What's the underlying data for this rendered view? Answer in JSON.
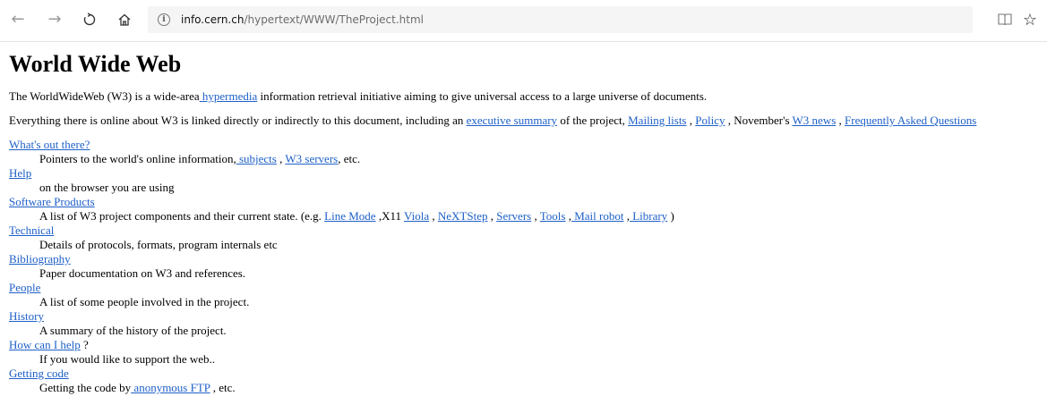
{
  "browser": {
    "url_host": "info.cern.ch",
    "url_path": "/hypertext/WWW/TheProject.html",
    "icons": [
      "back-arrow-icon",
      "forward-arrow-icon",
      "reload-icon",
      "home-icon",
      "info-icon",
      "reading-view-icon",
      "star-icon"
    ]
  },
  "page": {
    "title": "World Wide Web",
    "intro": {
      "t1": "The WorldWideWeb (W3) is a wide-area",
      "link_hypermedia": " hypermedia",
      "t2": " information retrieval initiative aiming to give universal access to a large universe of documents."
    },
    "everything": {
      "t1": "Everything there is online about W3 is linked directly or indirectly to this document, including an ",
      "link_exec": "executive summary",
      "t2": " of the project, ",
      "link_mailing": "Mailing lists",
      "t3": " , ",
      "link_policy": "Policy",
      "t4": " , November's ",
      "link_news": "W3 news",
      "t5": " , ",
      "link_faq": "Frequently Asked Questions"
    },
    "sections": {
      "out_there": {
        "title": "What's out there?",
        "d1": "Pointers to the world's online information,",
        "link_subjects": " subjects",
        "d2": " , ",
        "link_servers": "W3 servers",
        "d3": ", etc."
      },
      "help": {
        "title": "Help",
        "desc": "on the browser you are using"
      },
      "software": {
        "title": "Software Products",
        "d1": "A list of W3 project components and their current state. (e.g. ",
        "link_linemode": "Line Mode",
        "d2": " ,X11 ",
        "link_viola": "Viola",
        "d3": " , ",
        "link_nextstep": "NeXTStep",
        "d4": " , ",
        "link_servers": "Servers",
        "d5": " , ",
        "link_tools": "Tools",
        "d6": " ,",
        "link_mailrobot": " Mail robot",
        "d7": " ,",
        "link_library": " Library",
        "d8": " )"
      },
      "technical": {
        "title": "Technical",
        "desc": "Details of protocols, formats, program internals etc"
      },
      "bibliography": {
        "title": "Bibliography",
        "desc": "Paper documentation on W3 and references."
      },
      "people": {
        "title": "People",
        "desc": "A list of some people involved in the project."
      },
      "history": {
        "title": "History",
        "desc": "A summary of the history of the project."
      },
      "how_help": {
        "title": "How can I help",
        "suffix": " ?",
        "desc": "If you would like to support the web.."
      },
      "getting_code": {
        "title": "Getting code",
        "d1": "Getting the code by",
        "link_ftp": " anonymous FTP",
        "d2": " , etc."
      }
    }
  }
}
